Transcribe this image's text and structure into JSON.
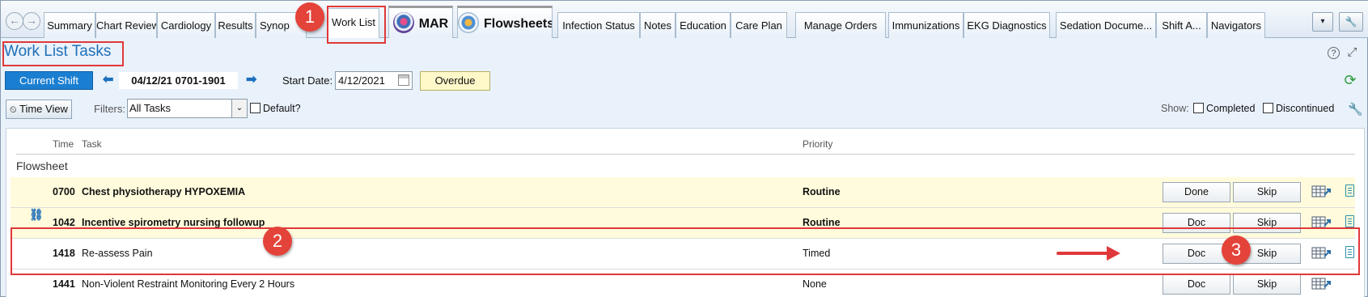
{
  "tabs": {
    "items": [
      {
        "label": "Summary"
      },
      {
        "label": "Chart Review"
      },
      {
        "label": "Cardiology"
      },
      {
        "label": "Results"
      },
      {
        "label": "Synop"
      },
      {
        "label": "Work List"
      },
      {
        "label": "MAR"
      },
      {
        "label": "Flowsheets"
      },
      {
        "label": "Infection Status"
      },
      {
        "label": "Notes"
      },
      {
        "label": "Education"
      },
      {
        "label": "Care Plan"
      },
      {
        "label": "Manage Orders"
      },
      {
        "label": "Immunizations"
      },
      {
        "label": "EKG Diagnostics"
      },
      {
        "label": "Sedation Docume..."
      },
      {
        "label": "Shift A..."
      },
      {
        "label": "Navigators"
      }
    ],
    "active": "Work List",
    "dropdown_glyph": "▾",
    "wrench_glyph": "🔧"
  },
  "header": {
    "title": "Work List Tasks",
    "help_glyph": "?",
    "expand_glyph": "⤢"
  },
  "controls": {
    "current_shift_label": "Current Shift",
    "prev_glyph": "⬅",
    "next_glyph": "➡",
    "shift_range": "04/12/21 0701-1901",
    "start_date_label": "Start Date:",
    "start_date_value": "4/12/2021",
    "overdue_label": "Overdue",
    "refresh_glyph": "⟳"
  },
  "filters": {
    "time_view_label": "Time View",
    "time_view_glyph": "⏲",
    "filters_label": "Filters:",
    "filter_value": "All Tasks",
    "caret_glyph": "⌄",
    "default_label": "Default?",
    "show_label": "Show:",
    "completed_label": "Completed",
    "discontinued_label": "Discontinued"
  },
  "grid": {
    "columns": {
      "time": "Time",
      "task": "Task",
      "priority": "Priority"
    },
    "section": "Flowsheet",
    "rows": [
      {
        "time": "0700",
        "task": "Chest physiotherapy HYPOXEMIA",
        "priority": "Routine",
        "action": "Done",
        "skip": "Skip"
      },
      {
        "time": "1042",
        "task": "Incentive spirometry nursing followup",
        "priority": "Routine",
        "action": "Doc",
        "skip": "Skip"
      },
      {
        "time": "1418",
        "task": "Re-assess Pain",
        "priority": "Timed",
        "action": "Doc",
        "skip": "Skip"
      },
      {
        "time": "1441",
        "task": "Non-Violent Restraint Monitoring Every 2 Hours",
        "priority": "None",
        "action": "Doc",
        "skip": "Skip"
      }
    ],
    "link_glyph": "⛓"
  },
  "annotations": {
    "badges": [
      "1",
      "2",
      "3"
    ],
    "color": "#e0383a"
  }
}
